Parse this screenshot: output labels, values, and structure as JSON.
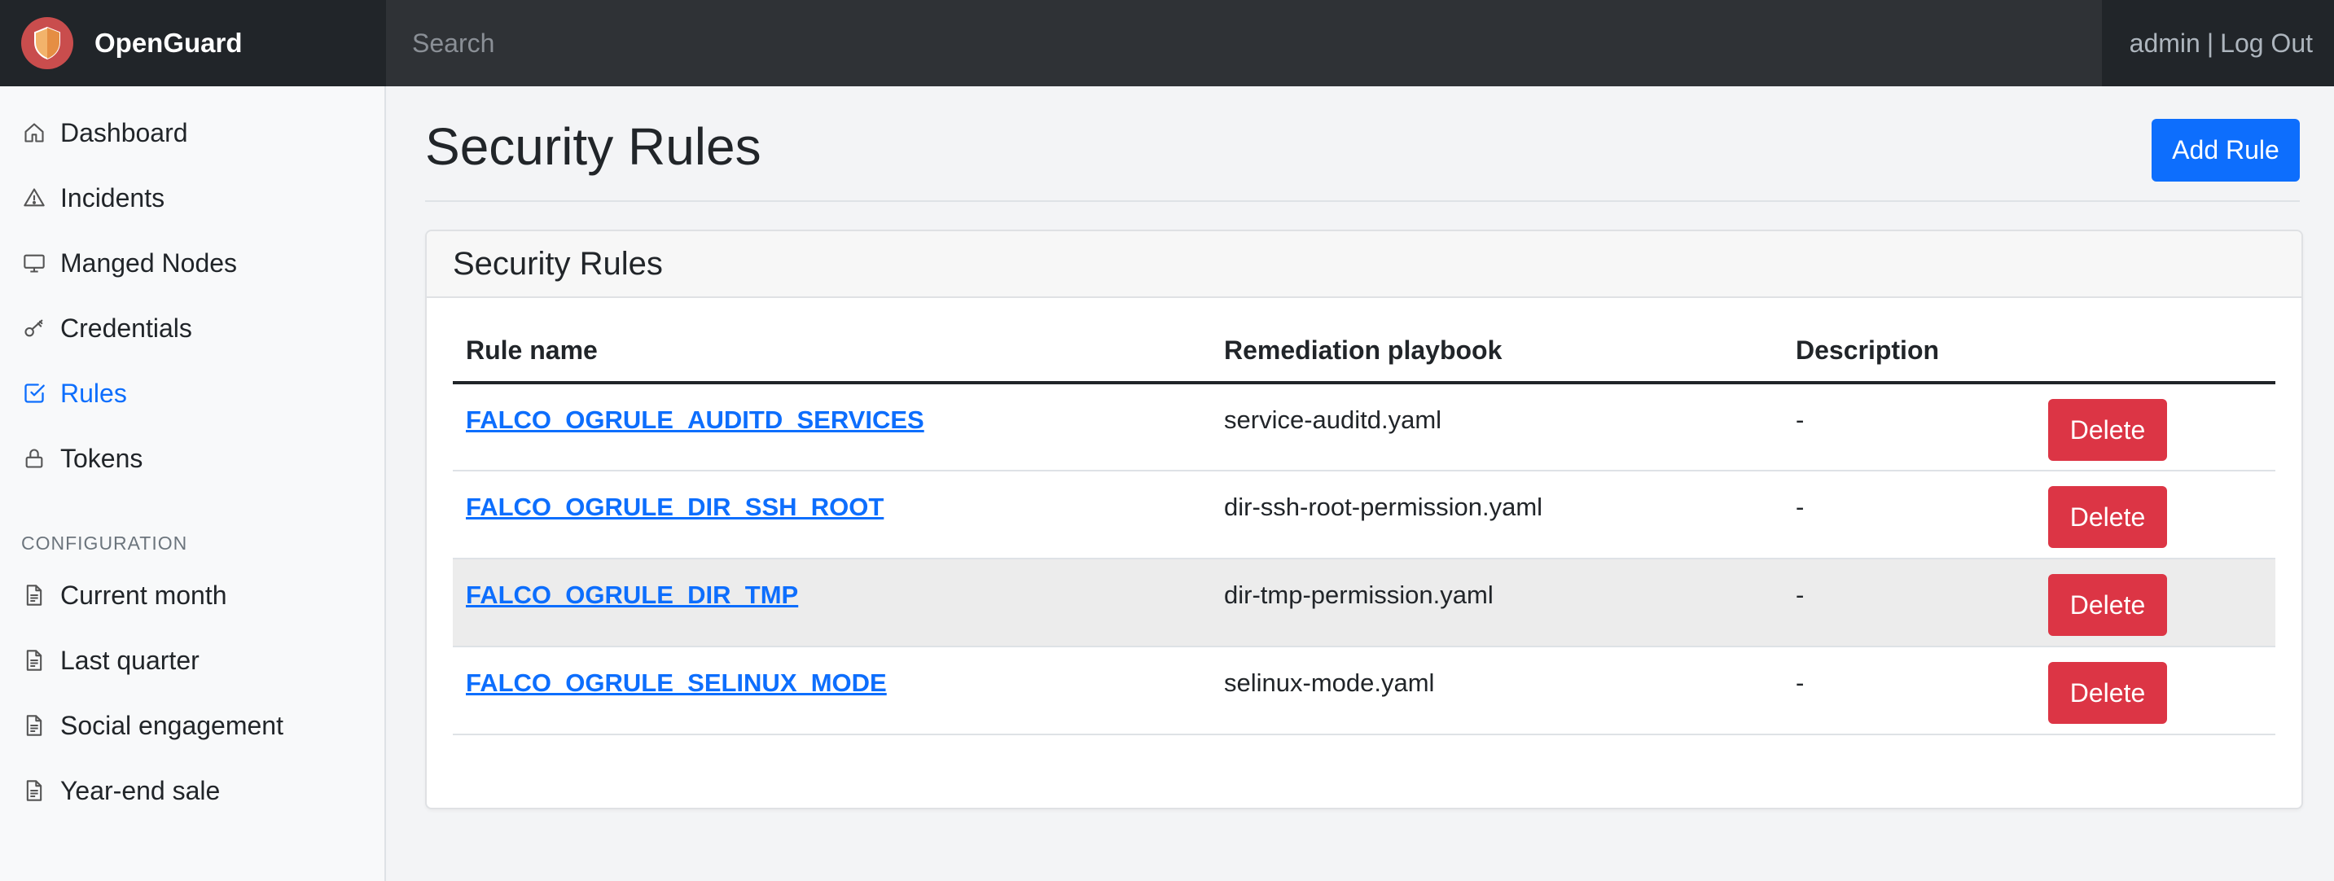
{
  "brand": {
    "name": "OpenGuard",
    "logo_color": "#c94d4d",
    "shield_color": "#f2b36b"
  },
  "search": {
    "placeholder": "Search",
    "value": ""
  },
  "user": {
    "name": "admin",
    "separator": "|",
    "logout_label": "Log Out"
  },
  "sidebar": {
    "items": [
      {
        "label": "Dashboard",
        "icon": "home-icon"
      },
      {
        "label": "Incidents",
        "icon": "alert-triangle-icon"
      },
      {
        "label": "Manged Nodes",
        "icon": "monitor-icon"
      },
      {
        "label": "Credentials",
        "icon": "key-icon"
      },
      {
        "label": "Rules",
        "icon": "check-square-icon",
        "active": true
      },
      {
        "label": "Tokens",
        "icon": "lock-icon"
      }
    ],
    "section_heading": "CONFIGURATION",
    "config_items": [
      {
        "label": "Current month",
        "icon": "file-text-icon"
      },
      {
        "label": "Last quarter",
        "icon": "file-text-icon"
      },
      {
        "label": "Social engagement",
        "icon": "file-text-icon"
      },
      {
        "label": "Year-end sale",
        "icon": "file-text-icon"
      }
    ]
  },
  "main": {
    "title": "Security Rules",
    "add_button": "Add Rule",
    "card_title": "Security Rules",
    "table": {
      "headers": [
        "Rule name",
        "Remediation playbook",
        "Description",
        ""
      ],
      "rows": [
        {
          "rule": "FALCO_OGRULE_AUDITD_SERVICES",
          "playbook": "service-auditd.yaml",
          "description": "-",
          "action": "Delete"
        },
        {
          "rule": "FALCO_OGRULE_DIR_SSH_ROOT",
          "playbook": "dir-ssh-root-permission.yaml",
          "description": "-",
          "action": "Delete"
        },
        {
          "rule": "FALCO_OGRULE_DIR_TMP",
          "playbook": "dir-tmp-permission.yaml",
          "description": "-",
          "action": "Delete"
        },
        {
          "rule": "FALCO_OGRULE_SELINUX_MODE",
          "playbook": "selinux-mode.yaml",
          "description": "-",
          "action": "Delete"
        }
      ]
    }
  },
  "colors": {
    "navbar": "#212529",
    "primary": "#0d6efd",
    "danger": "#dc3545"
  }
}
